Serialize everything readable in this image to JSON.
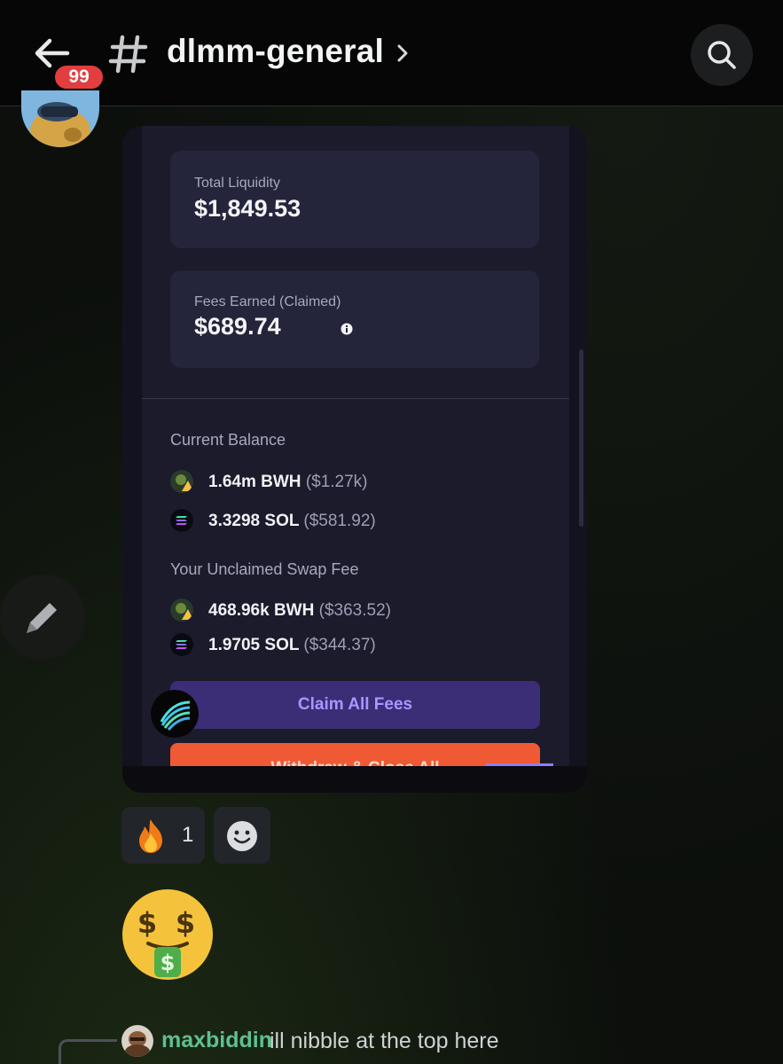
{
  "header": {
    "back_icon": "arrow-left-icon",
    "unread_count": "99",
    "channel_name": "dlmm-general",
    "channel_icon": "hash-icon",
    "search_icon": "search-icon"
  },
  "embedded_screenshot": {
    "total_liquidity": {
      "label": "Total Liquidity",
      "value": "$1,849.53"
    },
    "fees_earned": {
      "label": "Fees Earned (Claimed)",
      "value": "$689.74"
    },
    "current_balance": {
      "title": "Current Balance",
      "items": [
        {
          "amount": "1.64m BWH",
          "usd": "($1.27k)",
          "icon": "bwh-token-icon"
        },
        {
          "amount": "3.3298 SOL",
          "usd": "($581.92)",
          "icon": "sol-token-icon"
        }
      ]
    },
    "unclaimed_swap_fee": {
      "title": "Your Unclaimed Swap Fee",
      "items": [
        {
          "amount": "468.96k BWH",
          "usd": "($363.52)",
          "icon": "bwh-token-icon"
        },
        {
          "amount": "1.9705 SOL",
          "usd": "($344.37)",
          "icon": "sol-token-icon"
        }
      ]
    },
    "claim_button": "Claim All Fees",
    "withdraw_button": "Withdraw & Close All"
  },
  "reactions": [
    {
      "emoji": "fire-icon",
      "count": "1"
    },
    {
      "emoji": "add-reaction-icon"
    }
  ],
  "message_emoji": "money-mouth-face-icon",
  "reply": {
    "username": "maxbiddin",
    "text": "ill nibble at the top here"
  },
  "colors": {
    "accent_purple": "#3b2d76",
    "claim_text": "#a996ff",
    "withdraw_orange": "#ef5a35",
    "badge_red": "#e23d3f",
    "username_green": "#5fbf8f"
  }
}
